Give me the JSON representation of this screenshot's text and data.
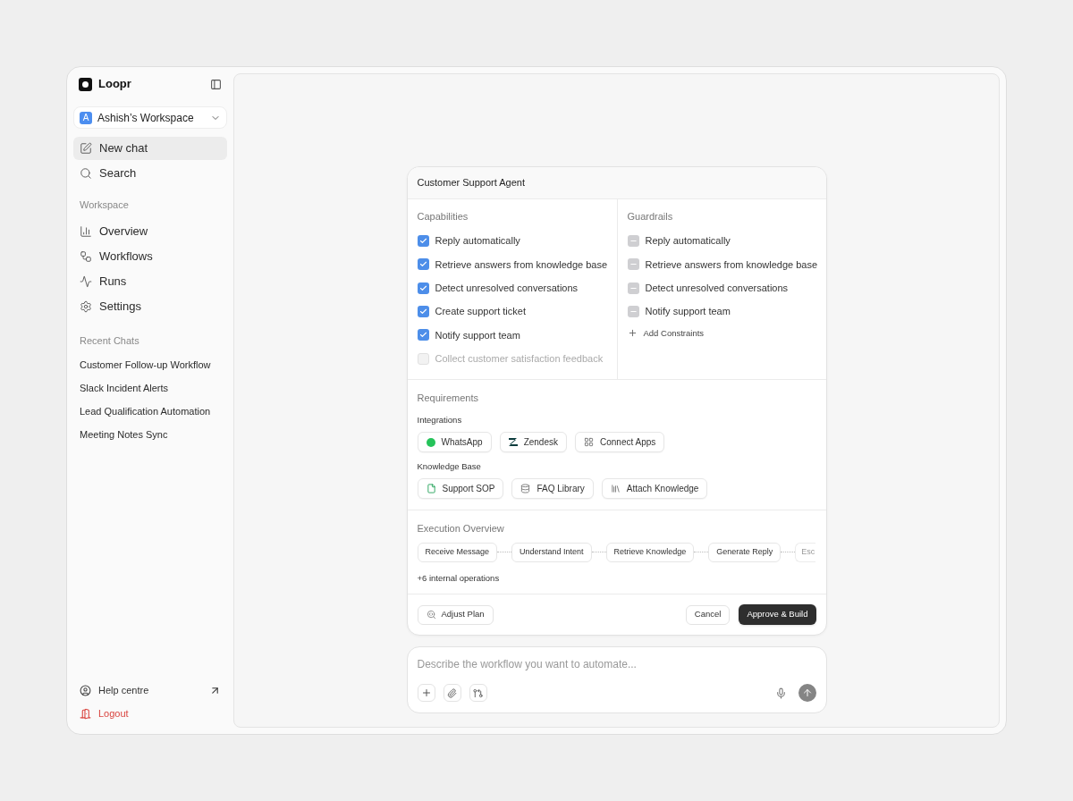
{
  "sidebar": {
    "brand": "Loopr",
    "workspace": {
      "initial": "A",
      "name": "Ashish’s Workspace"
    },
    "top_items": [
      {
        "label": "New chat",
        "selected": true
      },
      {
        "label": "Search",
        "selected": false
      }
    ],
    "workspace_section": {
      "title": "Workspace",
      "items": [
        {
          "label": "Overview",
          "selected": false
        },
        {
          "label": "Workflows",
          "selected": false
        },
        {
          "label": "Runs",
          "selected": false
        },
        {
          "label": "Settings",
          "selected": false
        }
      ]
    },
    "recent_section": {
      "title": "Recent Chats",
      "items": [
        "Customer Follow-up Workflow",
        "Slack Incident Alerts",
        "Lead Qualification Automation",
        "Meeting Notes Sync"
      ]
    },
    "help": "Help centre",
    "logout": "Logout"
  },
  "plan": {
    "title": "Customer Support Agent",
    "capabilities": {
      "title": "Capabilities",
      "items": [
        {
          "label": "Reply automatically",
          "checked": true,
          "disabled": false
        },
        {
          "label": "Retrieve answers from knowledge base",
          "checked": true,
          "disabled": false
        },
        {
          "label": "Detect unresolved conversations",
          "checked": true,
          "disabled": false
        },
        {
          "label": "Create support ticket",
          "checked": true,
          "disabled": false
        },
        {
          "label": "Notify support team",
          "checked": true,
          "disabled": false
        },
        {
          "label": "Collect customer satisfaction feedback",
          "checked": false,
          "disabled": true
        }
      ]
    },
    "guardrails": {
      "title": "Guardrails",
      "items": [
        {
          "label": "Reply automatically",
          "indeterminate": true
        },
        {
          "label": "Retrieve answers from knowledge base",
          "indeterminate": true
        },
        {
          "label": "Detect unresolved conversations",
          "indeterminate": true
        },
        {
          "label": "Notify support team",
          "indeterminate": true
        }
      ],
      "add": "Add Constraints"
    },
    "requirements": {
      "title": "Requirements",
      "groups": [
        {
          "title": "Integrations",
          "chips": [
            "WhatsApp",
            "Zendesk",
            "Connect Apps"
          ]
        },
        {
          "title": "Knowledge Base",
          "chips": [
            "Support SOP",
            "FAQ Library",
            "Attach Knowledge"
          ]
        }
      ]
    },
    "execution": {
      "title": "Execution Overview",
      "steps": [
        {
          "label": "Receive Message",
          "faded": false
        },
        {
          "label": "Understand Intent",
          "faded": false
        },
        {
          "label": "Retrieve Knowledge",
          "faded": false
        },
        {
          "label": "Generate Reply",
          "faded": false
        },
        {
          "label": "Esc",
          "faded": true
        }
      ],
      "more": "+6 internal operations"
    },
    "actions": {
      "adjust": "Adjust Plan",
      "cancel": "Cancel",
      "approve": "Approve & Build"
    }
  },
  "composer": {
    "placeholder": "Describe the workflow you want to automate..."
  }
}
